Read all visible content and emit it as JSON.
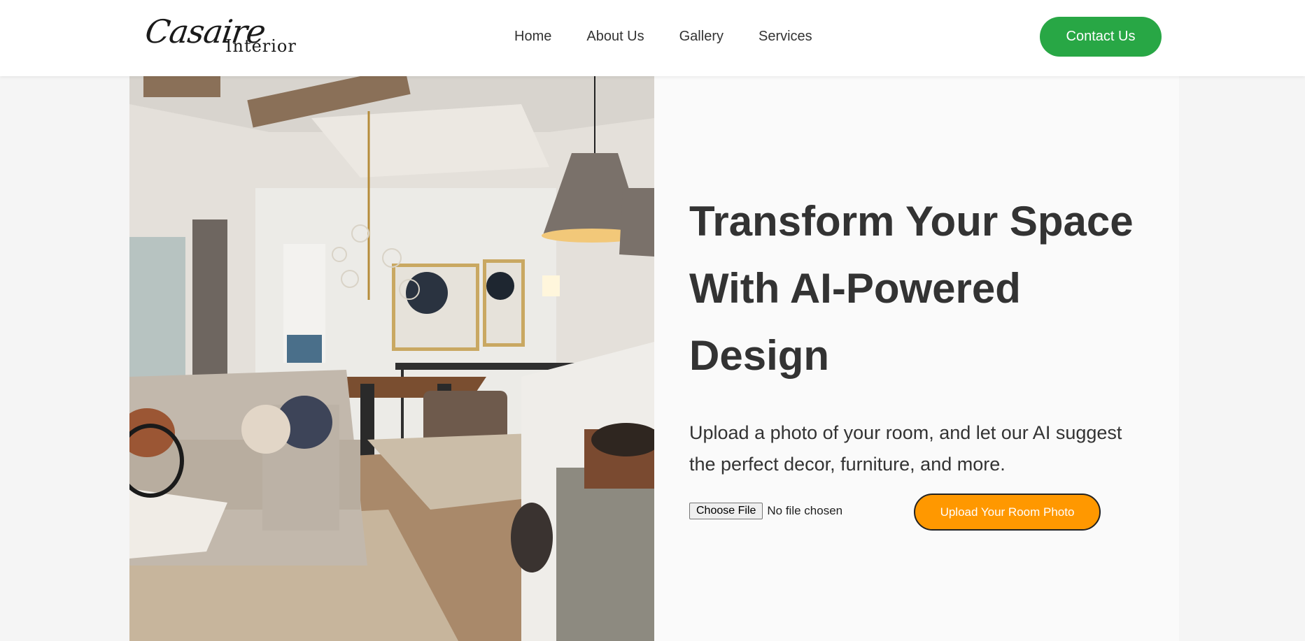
{
  "brand": {
    "name_script": "Casaire",
    "name_sub": "Interior"
  },
  "nav": {
    "items": [
      "Home",
      "About Us",
      "Gallery",
      "Services"
    ]
  },
  "header": {
    "contact_label": "Contact Us"
  },
  "hero": {
    "title_line1": "Transform Your Space",
    "title_line2": "With AI-Powered",
    "title_line3": "Design",
    "description_line1": "Upload a photo of your room, and let our AI suggest",
    "description_line2": "the perfect decor, furniture, and more.",
    "file_button_label": "Choose File",
    "file_status": "No file chosen",
    "upload_label": "Upload Your Room Photo"
  },
  "colors": {
    "accent_green": "#28a745",
    "accent_orange": "#ff9800",
    "text": "#333333"
  },
  "icons": {
    "hero_image": "living-room-photo"
  }
}
